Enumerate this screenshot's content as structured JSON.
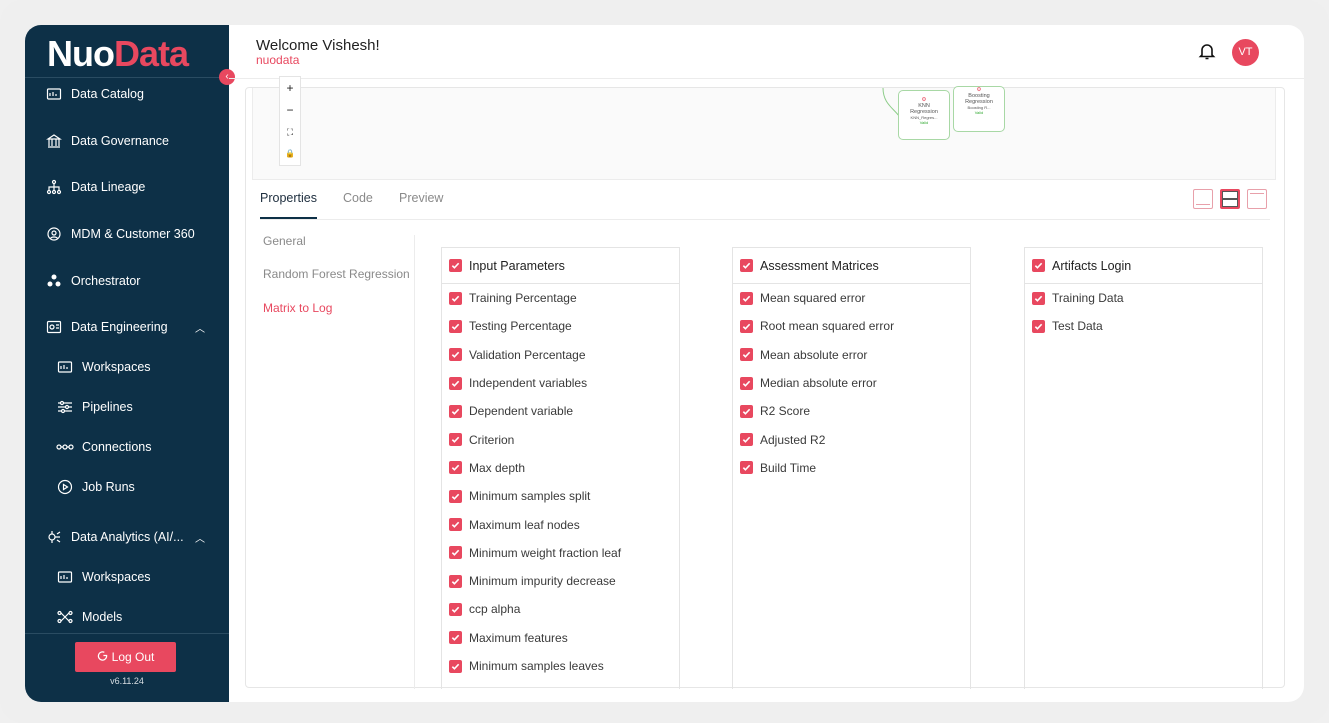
{
  "brand": {
    "logo_part1": "Nuo",
    "logo_part2": "Data",
    "accent": "#e8485f",
    "sidebar_bg": "#0d3047"
  },
  "sidebar": {
    "items": [
      {
        "label": "Data Catalog",
        "icon": "catalog-icon"
      },
      {
        "label": "Data Governance",
        "icon": "governance-icon"
      },
      {
        "label": "Data Lineage",
        "icon": "lineage-icon"
      },
      {
        "label": "MDM & Customer 360",
        "icon": "mdm-icon"
      },
      {
        "label": "Orchestrator",
        "icon": "orchestrator-icon"
      },
      {
        "label": "Data Engineering",
        "icon": "engineering-icon",
        "expanded": true
      },
      {
        "label": "Workspaces",
        "icon": "workspaces-icon",
        "sub": true
      },
      {
        "label": "Pipelines",
        "icon": "pipelines-icon",
        "sub": true
      },
      {
        "label": "Connections",
        "icon": "connections-icon",
        "sub": true
      },
      {
        "label": "Job Runs",
        "icon": "job-runs-icon",
        "sub": true
      },
      {
        "label": "Data Analytics (AI/...",
        "icon": "analytics-icon",
        "expanded": true
      },
      {
        "label": "Workspaces",
        "icon": "workspaces-icon",
        "sub": true
      },
      {
        "label": "Models",
        "icon": "models-icon",
        "sub": true
      }
    ],
    "logout_label": "Log Out",
    "version": "v6.11.24"
  },
  "header": {
    "welcome": "Welcome Vishesh!",
    "subbrand": "nuodata",
    "avatar_initials": "VT"
  },
  "canvas": {
    "zoom_controls": [
      "+",
      "−",
      "⛶",
      "🔒"
    ],
    "nodes": [
      {
        "title": "KNN Regression",
        "sub": "KNN_Regres...",
        "status": "Valid"
      },
      {
        "title": "Boosting Regression",
        "sub": "Boosting R...",
        "status": "Valid"
      }
    ]
  },
  "tabs": [
    "Properties",
    "Code",
    "Preview"
  ],
  "side_menu": [
    "General",
    "Random Forest Regression",
    "Matrix to Log"
  ],
  "columns": [
    {
      "title": "Input Parameters",
      "items": [
        "Training Percentage",
        "Testing Percentage",
        "Validation Percentage",
        "Independent variables",
        "Dependent variable",
        "Criterion",
        "Max depth",
        "Minimum samples split",
        "Maximum leaf nodes",
        "Minimum weight fraction leaf",
        "Minimum impurity decrease",
        "ccp alpha",
        "Maximum features",
        "Minimum samples leaves"
      ]
    },
    {
      "title": "Assessment Matrices",
      "items": [
        "Mean squared error",
        "Root mean squared error",
        "Mean absolute error",
        "Median absolute error",
        "R2 Score",
        "Adjusted R2",
        "Build Time"
      ]
    },
    {
      "title": "Artifacts Login",
      "items": [
        "Training Data",
        "Test Data"
      ]
    }
  ]
}
